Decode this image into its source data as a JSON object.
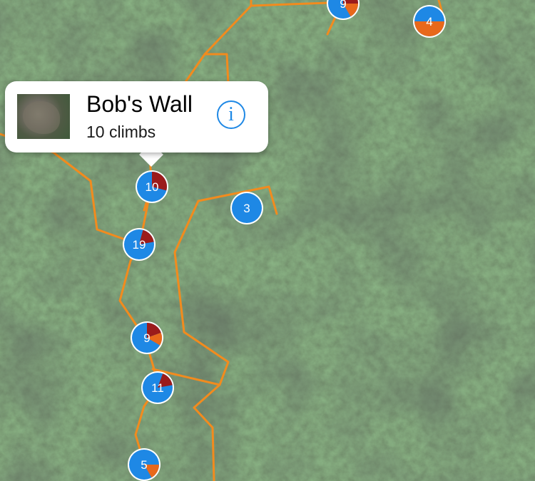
{
  "map": {
    "trail_color": "#f28b1e",
    "markers": [
      {
        "id": "top-center",
        "label": "9",
        "colors": {
          "blue": "#1e88e5",
          "red": "#9b1b1b",
          "orange": "#e8681b"
        }
      },
      {
        "id": "top-right",
        "label": "4"
      },
      {
        "id": "bobs-wall",
        "label": "10"
      },
      {
        "id": "mid-right",
        "label": "3"
      },
      {
        "id": "left-mid",
        "label": "19"
      },
      {
        "id": "lower-9",
        "label": "9"
      },
      {
        "id": "lower-11",
        "label": "11"
      },
      {
        "id": "bottom-5",
        "label": "5"
      }
    ]
  },
  "callout": {
    "title": "Bob's Wall",
    "subtitle": "10 climbs",
    "info_icon": "info-icon",
    "info_glyph": "i"
  }
}
